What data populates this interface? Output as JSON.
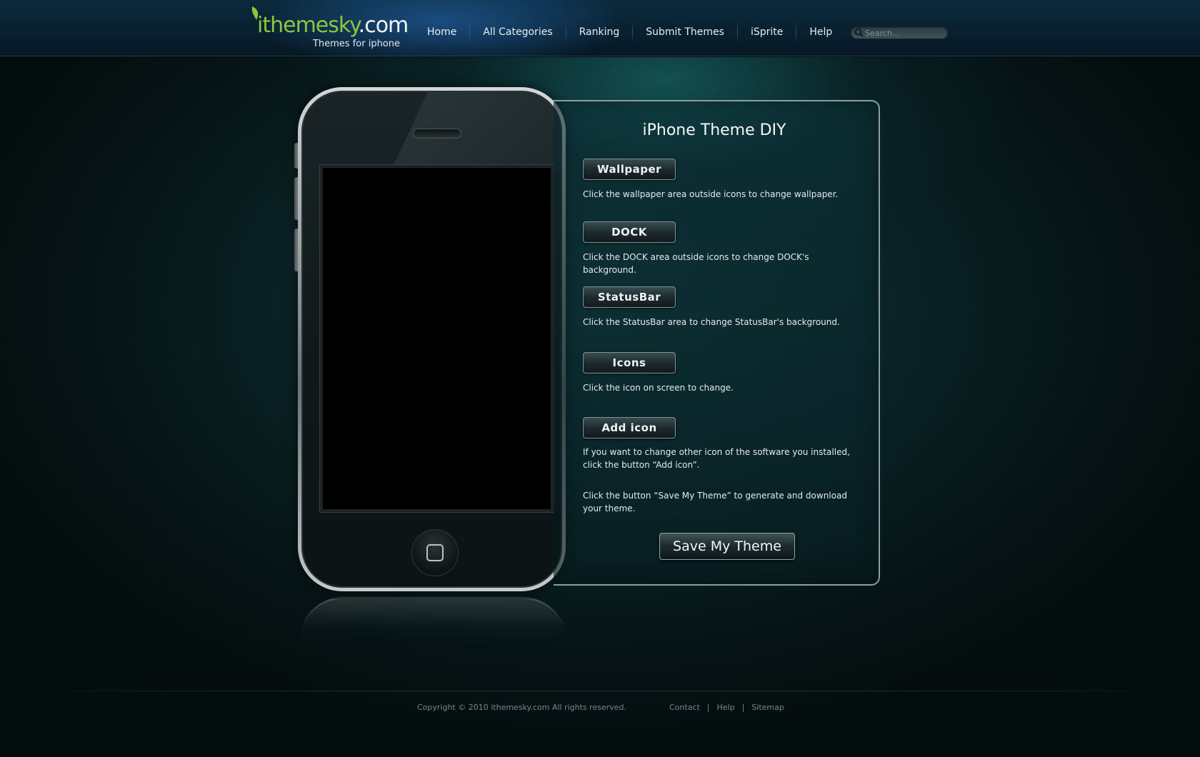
{
  "header": {
    "logo": {
      "part1": "ithemesky",
      "part2": ".com",
      "tagline": "Themes for iphone"
    },
    "nav": [
      {
        "label": "Home"
      },
      {
        "label": "All Categories"
      },
      {
        "label": "Ranking"
      },
      {
        "label": "Submit Themes"
      },
      {
        "label": "iSprite"
      },
      {
        "label": "Help"
      }
    ],
    "search": {
      "placeholder": "Search...",
      "value": ""
    }
  },
  "diy": {
    "title": "iPhone Theme DIY",
    "items": [
      {
        "button": "Wallpaper",
        "desc": "Click the wallpaper area outside icons to change wallpaper."
      },
      {
        "button": "DOCK",
        "desc": "Click the DOCK area outside icons to change DOCK's background."
      },
      {
        "button": "StatusBar",
        "desc": "Click the StatusBar area  to change StatusBar's background."
      },
      {
        "button": "Icons",
        "desc": "Click the icon on screen to change."
      },
      {
        "button": "Add icon",
        "desc": "If you want to change other icon of the software you installed, click the button “Add icon”."
      }
    ],
    "save_note": "Click the button “Save My Theme” to generate and download your theme.",
    "save_button": "Save My Theme"
  },
  "footer": {
    "copyright": "Copyright © 2010 ithemesky.com All rights reserved.",
    "links": [
      "Contact",
      "Help",
      "Sitemap"
    ],
    "separator": "|"
  },
  "colors": {
    "accent_green": "#8cc63f",
    "panel_border": "#8b9ea2"
  }
}
